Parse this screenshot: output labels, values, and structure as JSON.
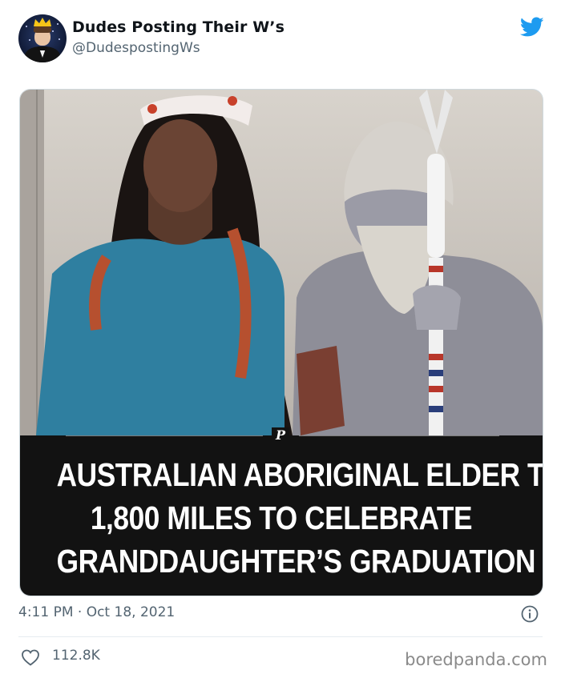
{
  "tweet": {
    "author_name": "Dudes Posting Their W’s",
    "author_handle": "@DudespostingWs",
    "timestamp": "4:11 PM · Oct 18, 2021",
    "likes": "112.8K"
  },
  "media": {
    "headline_lines": [
      "AUSTRALIAN ABORIGINAL ELDER TRAVELS",
      "1,800 MILES TO CELEBRATE",
      "GRANDDAUGHTER’S GRADUATION"
    ],
    "logo_letter": "P"
  },
  "footer": {
    "watermark": "boredpanda.com"
  },
  "icons": {
    "platform": "twitter-bird-icon",
    "info": "info-icon",
    "like": "heart-icon"
  },
  "colors": {
    "brand_blue": "#1d9bf0",
    "muted_text": "#536471",
    "panel_bg": "#121212"
  }
}
